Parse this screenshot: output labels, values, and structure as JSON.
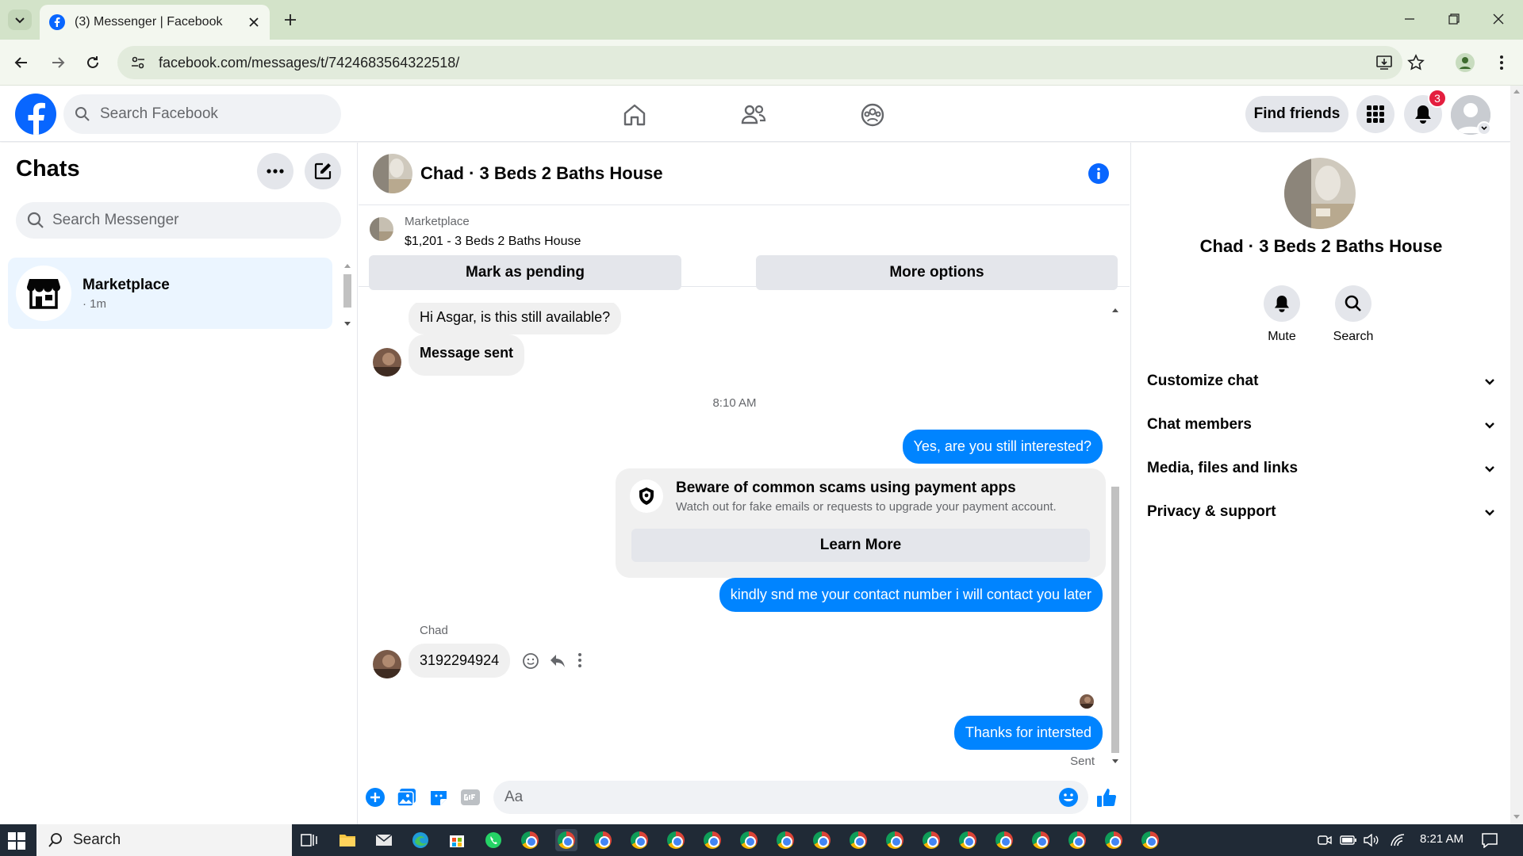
{
  "browser": {
    "tab_title": "(3) Messenger | Facebook",
    "url": "facebook.com/messages/t/7424683564322518/"
  },
  "header": {
    "search_placeholder": "Search Facebook",
    "find_friends": "Find friends",
    "notification_count": "3"
  },
  "sidebar": {
    "title": "Chats",
    "search_placeholder": "Search Messenger",
    "chats": [
      {
        "name": "Marketplace",
        "meta": "· 1m"
      }
    ]
  },
  "chat": {
    "title": "Chad · 3 Beds 2 Baths House",
    "marketplace_label": "Marketplace",
    "listing": "$1,201 - 3 Beds 2 Baths House",
    "mark_pending": "Mark as pending",
    "more_options": "More options",
    "messages": {
      "m1": "Hi Asgar, is this still available?",
      "m2": "Message sent",
      "time": "8:10 AM",
      "m3": "Yes, are you still interested?",
      "scam_title": "Beware of common scams using payment apps",
      "scam_desc": "Watch out for fake emails or requests to upgrade your payment account.",
      "learn_more": "Learn More",
      "m4": "kindly snd me your contact number i will contact you later",
      "sender_name": "Chad",
      "m5": "3192294924",
      "m6": "Thanks for intersted",
      "status": "Sent"
    },
    "composer_placeholder": "Aa"
  },
  "right_panel": {
    "name": "Chad · 3 Beds 2 Baths House",
    "mute": "Mute",
    "search": "Search",
    "sections": [
      "Customize chat",
      "Chat members",
      "Media, files and links",
      "Privacy & support"
    ]
  },
  "taskbar": {
    "search_placeholder": "Search",
    "time": "8:21 AM"
  },
  "colors": {
    "fb_blue": "#0866ff",
    "messenger_blue": "#0084ff",
    "badge_red": "#e41e3f",
    "chrome_tab_bg": "#d3e3c9"
  }
}
